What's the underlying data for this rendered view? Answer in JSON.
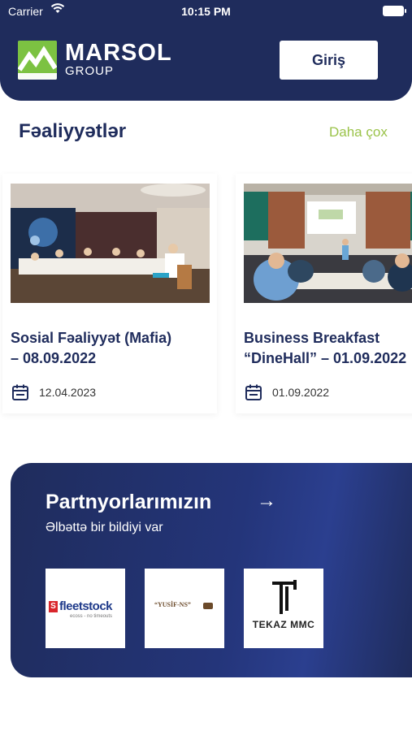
{
  "status_bar": {
    "carrier": "Carrier",
    "time": "10:15 PM"
  },
  "header": {
    "brand_name": "MARSOL",
    "brand_sub": "GROUP",
    "login_label": "Giriş",
    "background": "#1f2c5c",
    "logo_green": "#7cc242"
  },
  "activities": {
    "title": "Fəaliyyətlər",
    "more_label": "Daha çox",
    "cards": [
      {
        "title_line1": "Sosial Fəaliyyət (Mafia)",
        "title_line2": "– 08.09.2022",
        "date": "12.04.2023"
      },
      {
        "title_line1": "Business Breakfast",
        "title_line2": "“DineHall” – 01.09.2022",
        "date": "01.09.2022"
      }
    ]
  },
  "partners": {
    "title": "Partnyorlarımızın",
    "subtitle": "Əlbəttə bir bildiyi var",
    "tiles": [
      {
        "name": "fleetstock",
        "mark": "S",
        "tagline": "ecoss - no timeouts"
      },
      {
        "name": "“YUSİF-NS”"
      },
      {
        "name": "TEKAZ MMC"
      }
    ]
  }
}
